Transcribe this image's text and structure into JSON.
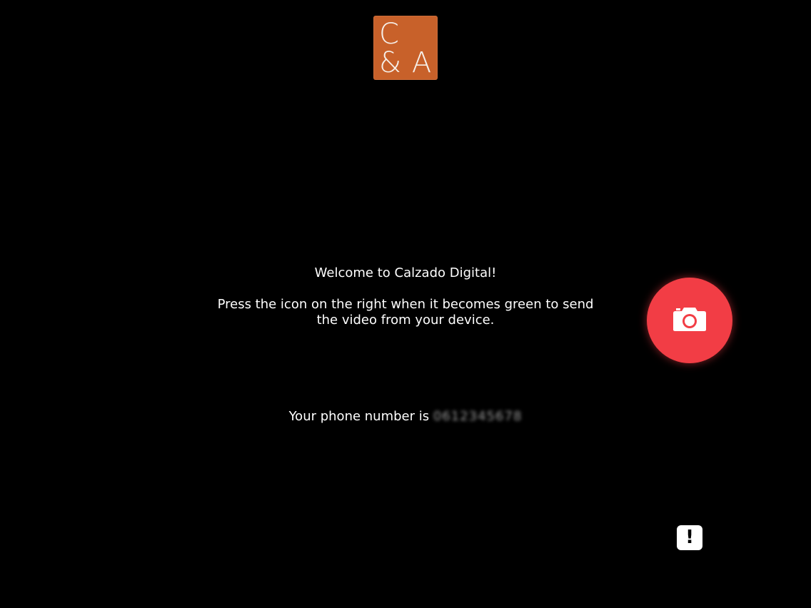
{
  "logo": {
    "line1": "C",
    "line2": "& A",
    "background_color": "#c8612a"
  },
  "content": {
    "welcome": "Welcome to Calzado Digital!",
    "instructions": "Press the icon on the right when it becomes green to send the video from your device.",
    "phone_prefix": "Your phone number is",
    "phone_number": "0612345678"
  },
  "camera_button": {
    "icon": "camera-icon",
    "color": "#f23d45"
  },
  "alert_button": {
    "icon": "exclamation-icon",
    "label": "!"
  },
  "colors": {
    "background": "#000000",
    "text": "#ffffff"
  }
}
